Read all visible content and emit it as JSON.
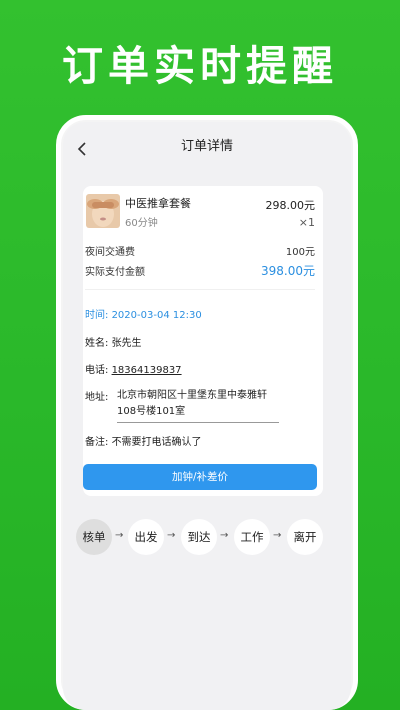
{
  "headline": "订单实时提醒",
  "nav": {
    "title": "订单详情",
    "back_icon": "chevron-left-icon"
  },
  "service": {
    "name": "中医推拿套餐",
    "duration": "60分钟",
    "price": "298.00元",
    "quantity": "×1"
  },
  "fees": {
    "night_fee_label": "夜间交通费",
    "night_fee_value": "100元",
    "total_label": "实际支付金额",
    "total_value": "398.00元"
  },
  "details": {
    "time_label": "时间:",
    "time_value": "2020-03-04 12:30",
    "name_label": "姓名:",
    "name_value": "张先生",
    "phone_label": "电话:",
    "phone_value": "18364139837",
    "address_label": "地址:",
    "address_value": "北京市朝阳区十里堡东里中泰雅轩108号楼101室",
    "note_label": "备注:",
    "note_value": "不需要打电话确认了"
  },
  "action_button": "加钟/补差价",
  "steps": [
    {
      "label": "核单",
      "active": true
    },
    {
      "label": "出发",
      "active": false
    },
    {
      "label": "到达",
      "active": false
    },
    {
      "label": "工作",
      "active": false
    },
    {
      "label": "离开",
      "active": false
    }
  ],
  "step_arrow": "→",
  "colors": {
    "background_green": "#2ab82a",
    "accent_blue": "#2f97ee",
    "price_blue": "#2b8fe0"
  }
}
